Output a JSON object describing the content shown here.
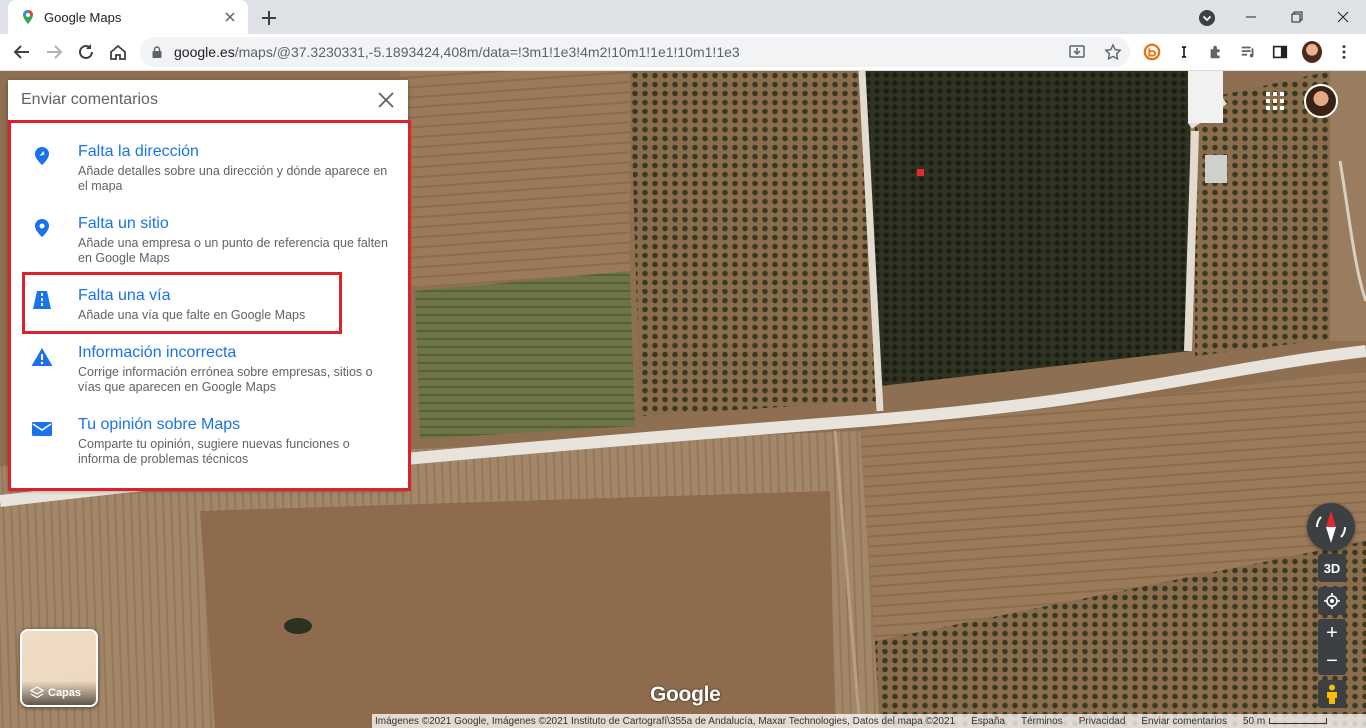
{
  "browser": {
    "tab_title": "Google Maps",
    "url_host": "google.es",
    "url_path": "/maps/@37.3230331,-5.1893424,408m/data=!3m1!1e3!4m2!10m1!1e1!10m1!1e3"
  },
  "feedback_panel": {
    "title": "Enviar comentarios",
    "items": [
      {
        "icon": "address-pin-icon",
        "title": "Falta la dirección",
        "description": "Añade detalles sobre una dirección y dónde aparece en el mapa"
      },
      {
        "icon": "place-pin-icon",
        "title": "Falta un sitio",
        "description": "Añade una empresa o un punto de referencia que falten en Google Maps"
      },
      {
        "icon": "road-icon",
        "title": "Falta una vía",
        "description": "Añade una vía que falte en Google Maps"
      },
      {
        "icon": "warning-icon",
        "title": "Información incorrecta",
        "description": "Corrige información errónea sobre empresas, sitios o vías que aparecen en Google Maps"
      },
      {
        "icon": "mail-icon",
        "title": "Tu opinión sobre Maps",
        "description": "Comparte tu opinión, sugiere nuevas funciones o informa de problemas técnicos"
      }
    ]
  },
  "map_controls": {
    "tilt_label": "3D",
    "zoom_in": "+",
    "zoom_out": "−",
    "layers_label": "Capas"
  },
  "logo_text": "Google",
  "footer": {
    "credits": "Imágenes ©2021 Google, Imágenes ©2021 Instituto de Cartografí\\355a de Andalucía, Maxar Technologies, Datos del mapa ©2021",
    "country": "España",
    "terms": "Términos",
    "privacy": "Privacidad",
    "send_feedback": "Enviar comentarios",
    "scale": "50 m"
  },
  "colors": {
    "accent": "#1a73e8",
    "highlight": "#d9222a"
  }
}
